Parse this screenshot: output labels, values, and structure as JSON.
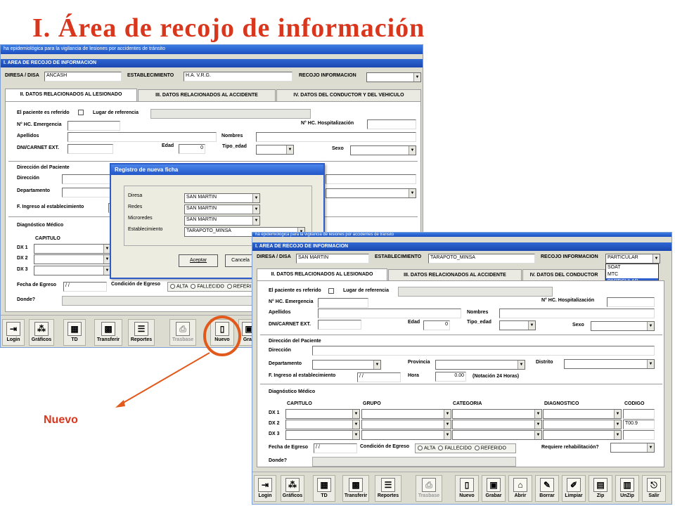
{
  "slide": {
    "title": "I. Área de recojo de información",
    "callout": "Nuevo"
  },
  "colors": {
    "accent": "#d9361e",
    "titlebar": "#1c4fc0"
  },
  "back": {
    "window_title": "ha epidemiológica para la vigilancia de lesiones por accidentes de tránsito",
    "section": "I. AREA DE RECOJO DE INFORMACION",
    "diresa_label": "DIRESA / DISA",
    "diresa_value": "ANCASH",
    "establecimiento_label": "ESTABLECIMIENTO",
    "establecimiento_value": "H.A. V.R.G.",
    "recojo_label": "RECOJO INFORMACION",
    "recojo_value": "",
    "tabs": [
      "II. DATOS RELACIONADOS AL LESIONADO",
      "III. DATOS RELACIONADOS AL ACCIDENTE",
      "IV. DATOS DEL CONDUCTOR Y DEL VEHICULO"
    ],
    "referido_label": "El paciente es referido",
    "lugar_label": "Lugar de referencia",
    "hc_emergencia": "N° HC. Emergencia",
    "hc_hosp": "N° HC. Hospitalización",
    "apellidos": "Apellidos",
    "nombres": "Nombres",
    "dni": "DNI/CARNET EXT.",
    "edad": "Edad",
    "edad_value": "0",
    "tipo_edad": "Tipo_edad",
    "sexo": "Sexo",
    "dir_paciente": "Dirección del Paciente",
    "direccion": "Dirección",
    "departamento": "Departamento",
    "f_ingreso": "F. Ingreso al establecimiento",
    "diagnostico": "Diagnóstico Médico",
    "capitulo": "CAPITULO",
    "dx1": "DX 1",
    "dx2": "DX 2",
    "dx3": "DX 3",
    "fecha_egreso": "Fecha de Egreso",
    "fecha_egreso_value": "/ /",
    "condicion": "Condición de Egreso",
    "alta": "ALTA",
    "fallecido": "FALLECIDO",
    "referido": "REFERI",
    "donde": "Donde?"
  },
  "dialog": {
    "title": "Registro de nueva ficha",
    "diresa_label": "Diresa",
    "diresa_value": "SAN MARTIN",
    "redes_label": "Redes",
    "redes_value": "SAN MARTIN",
    "microredes_label": "Microredes",
    "microredes_value": "SAN MARTIN",
    "establecimiento_label": "Establecimiento",
    "establecimiento_value": "TARAPOTO_MINSA",
    "accept": "Aceptar",
    "cancel": "Cancela"
  },
  "toolbar_back": [
    {
      "label": "Login",
      "icon": "login-icon"
    },
    {
      "label": "Gráficos",
      "icon": "chart-icon"
    },
    {
      "label": "TD",
      "icon": "excel-icon"
    },
    {
      "label": "Transferir",
      "icon": "transfer-icon"
    },
    {
      "label": "Reportes",
      "icon": "reports-icon"
    },
    {
      "label": "Trasbase",
      "icon": "printer-icon"
    },
    {
      "label": "Nuevo",
      "icon": "new-file-icon"
    },
    {
      "label": "Grab",
      "icon": "save-icon"
    }
  ],
  "front": {
    "window_title": "ha epidemiológica para la vigilancia de lesiones por accidentes de tránsito",
    "section": "I. AREA DE RECOJO DE INFORMACION",
    "diresa_label": "DIRESA / DISA",
    "diresa_value": "SAN MARTIN",
    "establecimiento_label": "ESTABLECIMIENTO",
    "establecimiento_value": "TARAPOTO_MINSA",
    "recojo_label": "RECOJO INFORMACION",
    "recojo_value": "PARTICULAR",
    "recojo_options": [
      "SOAT",
      "MTC",
      "PARTICULAR"
    ],
    "tabs": [
      "II. DATOS RELACIONADOS AL LESIONADO",
      "III. DATOS RELACIONADOS AL ACCIDENTE",
      "IV. DATOS DEL CONDUCTOR"
    ],
    "referido_label": "El paciente es referido",
    "lugar_label": "Lugar de referencia",
    "hc_emergencia": "N° HC. Emergencia",
    "hc_hosp": "N° HC. Hospitalización",
    "apellidos": "Apellidos",
    "nombres": "Nombres",
    "dni": "DNI/CARNET EXT.",
    "edad": "Edad",
    "edad_value": "0",
    "tipo_edad": "Tipo_edad",
    "sexo": "Sexo",
    "dir_paciente": "Dirección del Paciente",
    "direccion": "Dirección",
    "departamento": "Departamento",
    "provincia": "Provincia",
    "distrito": "Distrito",
    "f_ingreso": "F. Ingreso al establecimiento",
    "f_ingreso_value": "/ /",
    "hora": "Hora",
    "hora_value": "0.00",
    "notacion": "(Notación 24 Horas)",
    "diagnostico": "Diagnóstico Médico",
    "col_capitulo": "CAPITULO",
    "col_grupo": "GRUPO",
    "col_categoria": "CATEGORIA",
    "col_diagnostico": "DIAGNOSTICO",
    "col_codigo": "CODIGO",
    "dx1": "DX 1",
    "dx2": "DX 2",
    "dx3": "DX 3",
    "dx2_code": "T00.9",
    "fecha_egreso": "Fecha de Egreso",
    "fecha_egreso_value": "/ /",
    "condicion": "Condición de Egreso",
    "alta": "ALTA",
    "fallecido": "FALLECIDO",
    "referido": "REFERIDO",
    "rehab": "Requiere rehabilitación?",
    "donde": "Donde?"
  },
  "toolbar_front": [
    {
      "label": "Login",
      "icon": "login-icon"
    },
    {
      "label": "Gráficos",
      "icon": "chart-icon"
    },
    {
      "label": "TD",
      "icon": "excel-icon"
    },
    {
      "label": "Transferir",
      "icon": "transfer-icon"
    },
    {
      "label": "Reportes",
      "icon": "reports-icon"
    },
    {
      "label": "Trasbase",
      "icon": "printer-icon"
    },
    {
      "label": "Nuevo",
      "icon": "new-file-icon"
    },
    {
      "label": "Grabar",
      "icon": "save-icon"
    },
    {
      "label": "Abrir",
      "icon": "open-folder-icon"
    },
    {
      "label": "Borrar",
      "icon": "eraser-icon"
    },
    {
      "label": "Limpiar",
      "icon": "broom-icon"
    },
    {
      "label": "Zip",
      "icon": "zip-icon"
    },
    {
      "label": "UnZip",
      "icon": "unzip-icon"
    },
    {
      "label": "Salir",
      "icon": "exit-icon"
    }
  ]
}
